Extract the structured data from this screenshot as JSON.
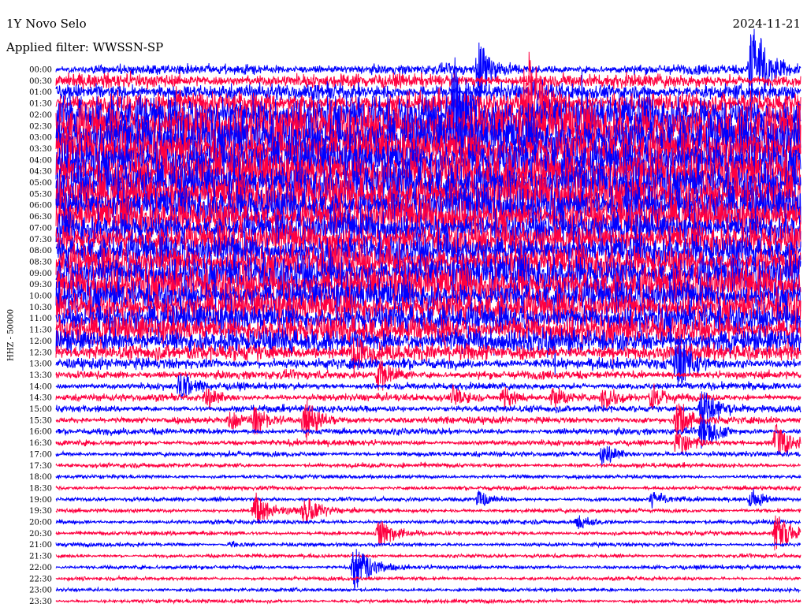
{
  "header": {
    "station": "1Y Novo Selo",
    "date": "2024-11-21",
    "filter": "Applied filter: WWSSN-SP"
  },
  "chart_data": {
    "type": "line",
    "title": "1Y Novo Selo",
    "subtitle": "Applied filter: WWSSN-SP",
    "date": "2024-11-21",
    "ylabel": "HHZ - 50000",
    "xlabel": "",
    "row_labels": [
      "00:00",
      "00:30",
      "01:00",
      "01:30",
      "02:00",
      "02:30",
      "03:00",
      "03:30",
      "04:00",
      "04:30",
      "05:00",
      "05:30",
      "06:00",
      "06:30",
      "07:00",
      "07:30",
      "08:00",
      "08:30",
      "09:00",
      "09:30",
      "10:00",
      "10:30",
      "11:00",
      "11:30",
      "12:00",
      "12:30",
      "13:00",
      "13:30",
      "14:00",
      "14:30",
      "15:00",
      "15:30",
      "16:00",
      "16:30",
      "17:00",
      "17:30",
      "18:00",
      "18:30",
      "19:00",
      "19:30",
      "20:00",
      "20:30",
      "21:00",
      "21:30",
      "22:00",
      "22:30",
      "23:00",
      "23:30"
    ],
    "row_minutes": 30,
    "trace_colors": [
      "#0000ff",
      "#ff0040"
    ],
    "noise_level": [
      3.5,
      5,
      6,
      8,
      14,
      18,
      18,
      14,
      16,
      16,
      16,
      16,
      14,
      14,
      12,
      12,
      12,
      12,
      14,
      14,
      12,
      12,
      11,
      11,
      9,
      6,
      4,
      3,
      2.5,
      2.5,
      2.5,
      2.5,
      2.2,
      2,
      1.8,
      1.6,
      1.4,
      1.4,
      1.5,
      1.5,
      1.5,
      1.5,
      1.4,
      1.3,
      1.4,
      1.3,
      1.3,
      1.3
    ],
    "events": [
      {
        "time": "00:00",
        "minute": 17,
        "amplitude": 40
      },
      {
        "time": "00:00",
        "minute": 28,
        "amplitude": 70
      },
      {
        "time": "00:00",
        "minute": 33,
        "amplitude": 60
      },
      {
        "time": "01:30",
        "minute": 19,
        "amplitude": 90
      },
      {
        "time": "02:00",
        "minute": 16,
        "amplitude": 80
      },
      {
        "time": "06:00",
        "minute": 23,
        "amplitude": 40
      },
      {
        "time": "08:30",
        "minute": 11,
        "amplitude": 45
      },
      {
        "time": "12:30",
        "minute": 12,
        "amplitude": 30
      },
      {
        "time": "13:00",
        "minute": 25,
        "amplitude": 40
      },
      {
        "time": "13:30",
        "minute": 13,
        "amplitude": 25
      },
      {
        "time": "14:00",
        "minute": 5,
        "amplitude": 20
      },
      {
        "time": "14:30",
        "minute": 6,
        "amplitude": 15
      },
      {
        "time": "14:30",
        "minute": 16,
        "amplitude": 14
      },
      {
        "time": "14:30",
        "minute": 18,
        "amplitude": 16
      },
      {
        "time": "14:30",
        "minute": 20,
        "amplitude": 15
      },
      {
        "time": "14:30",
        "minute": 22,
        "amplitude": 20
      },
      {
        "time": "14:30",
        "minute": 24,
        "amplitude": 16
      },
      {
        "time": "15:00",
        "minute": 26,
        "amplitude": 35
      },
      {
        "time": "15:30",
        "minute": 7,
        "amplitude": 12
      },
      {
        "time": "15:30",
        "minute": 8,
        "amplitude": 16
      },
      {
        "time": "15:30",
        "minute": 10,
        "amplitude": 30
      },
      {
        "time": "15:30",
        "minute": 25,
        "amplitude": 30
      },
      {
        "time": "16:00",
        "minute": 26,
        "amplitude": 25
      },
      {
        "time": "16:30",
        "minute": 25,
        "amplitude": 20
      },
      {
        "time": "16:30",
        "minute": 29,
        "amplitude": 25
      },
      {
        "time": "17:00",
        "minute": 22,
        "amplitude": 16
      },
      {
        "time": "19:00",
        "minute": 17,
        "amplitude": 12
      },
      {
        "time": "19:00",
        "minute": 24,
        "amplitude": 12
      },
      {
        "time": "19:00",
        "minute": 28,
        "amplitude": 14
      },
      {
        "time": "19:30",
        "minute": 8,
        "amplitude": 25
      },
      {
        "time": "19:30",
        "minute": 10,
        "amplitude": 22
      },
      {
        "time": "20:00",
        "minute": 21,
        "amplitude": 10
      },
      {
        "time": "20:30",
        "minute": 13,
        "amplitude": 22
      },
      {
        "time": "20:30",
        "minute": 29,
        "amplitude": 30
      },
      {
        "time": "21:00",
        "minute": 7,
        "amplitude": 5
      },
      {
        "time": "22:00",
        "minute": 12,
        "amplitude": 35
      }
    ]
  }
}
